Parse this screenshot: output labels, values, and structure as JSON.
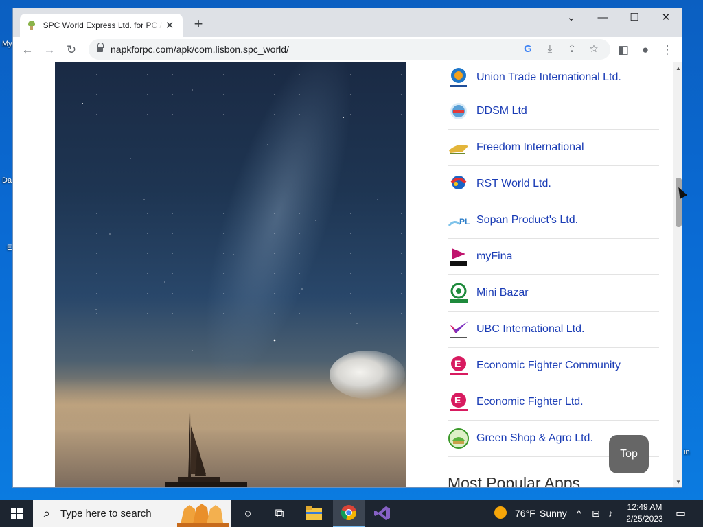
{
  "desktop": {
    "labels": [
      "My",
      "Da",
      "E",
      "in"
    ]
  },
  "browser": {
    "tab_title": "SPC World Express Ltd. for PC / M",
    "url": "napkforpc.com/apk/com.lisbon.spc_world/"
  },
  "company_list": [
    {
      "name": "Union Trade International Ltd."
    },
    {
      "name": "DDSM Ltd"
    },
    {
      "name": "Freedom International"
    },
    {
      "name": "RST World Ltd."
    },
    {
      "name": "Sopan Product's Ltd."
    },
    {
      "name": "myFina"
    },
    {
      "name": "Mini Bazar"
    },
    {
      "name": "UBC International Ltd."
    },
    {
      "name": "Economic Fighter Community"
    },
    {
      "name": "Economic Fighter Ltd."
    },
    {
      "name": "Green Shop & Agro Ltd."
    }
  ],
  "section_title": "Most Popular Apps",
  "top_button": "Top",
  "taskbar": {
    "search_placeholder": "Type here to search",
    "weather_temp": "76°F",
    "weather_text": "Sunny",
    "time": "12:49 AM",
    "date": "2/25/2023"
  },
  "colors": {
    "link": "#1a3cb5",
    "taskbar": "#1d2530",
    "desktop": "#0a64c8"
  }
}
